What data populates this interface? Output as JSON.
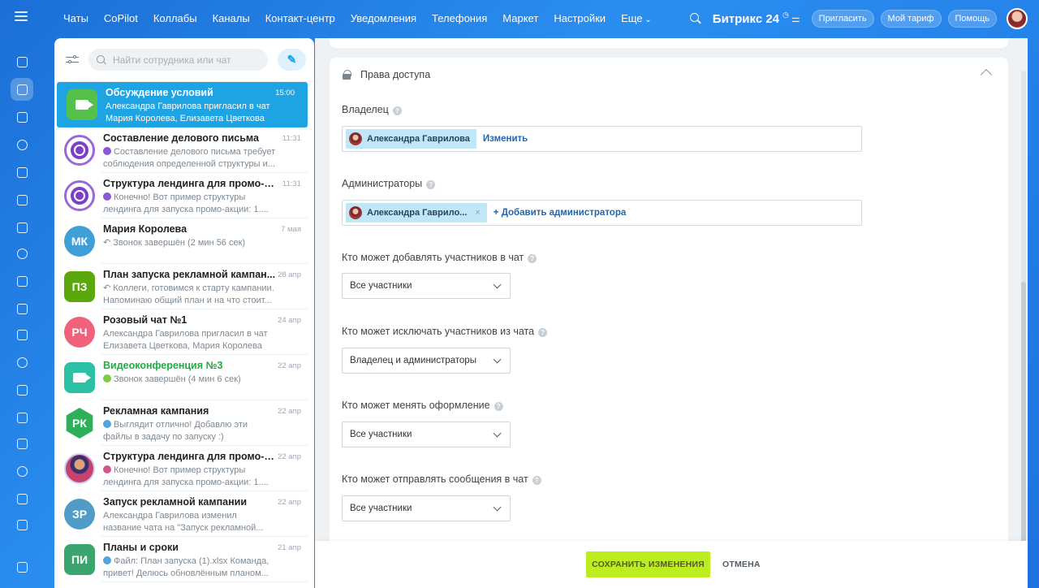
{
  "topnav": {
    "items": [
      "Чаты",
      "CoPilot",
      "Коллабы",
      "Каналы",
      "Контакт-центр",
      "Уведомления",
      "Телефония",
      "Маркет",
      "Настройки"
    ],
    "more": "Еще",
    "logo": "Битрикс 24",
    "invite": "Пригласить",
    "tariff": "Мой тариф",
    "help": "Помощь"
  },
  "rail": {
    "icons": [
      "bolt-icon",
      "chat-icon",
      "feed-icon",
      "copilot-icon",
      "calendar-icon",
      "docs-icon",
      "boards-icon",
      "drive-icon",
      "mail-icon",
      "contacts-icon",
      "tasks-icon",
      "crm-icon",
      "planner-icon",
      "store-icon",
      "goals-icon",
      "shop-icon",
      "forms-icon",
      "sign-icon",
      "settings-icon"
    ]
  },
  "chatlist": {
    "search_placeholder": "Найти сотрудника или чат",
    "compose": "✎",
    "items": [
      {
        "title": "Обсуждение условий",
        "time": "15:00",
        "text": "Александра Гаврилова пригласил в чат Мария Королева, Елизавета Цветкова",
        "avatar": "",
        "color": "#55c04a",
        "active": true
      },
      {
        "title": "Составление делового письма",
        "time": "11:31",
        "text": "Составление делового письма требует соблюдения определенной структуры и...",
        "avatar": "",
        "color": "#ffffff"
      },
      {
        "title": "Структура лендинга для промо-акц...",
        "time": "11:31",
        "text": "Конечно! Вот пример структуры лендинга для запуска промо-акции: 1....",
        "avatar": "",
        "color": "#ffffff"
      },
      {
        "title": "Мария Королева",
        "time": "7 мая",
        "text": "Звонок завершён (2 мин 56 сек)",
        "avatar": "МК",
        "color": "#3f9fd6"
      },
      {
        "title": "План запуска рекламной кампан...",
        "time": "28 апр",
        "text": "Коллеги, готовимся к старту кампании. Напоминаю общий план и на что стоит...",
        "avatar": "ПЗ",
        "color": "#5aa70e"
      },
      {
        "title": "Розовый чат №1",
        "time": "24 апр",
        "text": "Александра Гаврилова пригласил в чат Елизавета Цветкова, Мария Королева",
        "avatar": "РЧ",
        "color": "#f0617c"
      },
      {
        "title": "Видеоконференция №3",
        "time": "22 апр",
        "text": "Звонок завершён (4 мин 6 сек)",
        "avatar": "",
        "color": "#2cc0a4"
      },
      {
        "title": "Рекламная кампания",
        "time": "22 апр",
        "text": "Выглядит отлично! Добавлю эти файлы в задачу по запуску :)",
        "avatar": "РК",
        "color": "#2eb05a"
      },
      {
        "title": "Структура лендинга для промо-ак...",
        "time": "22 апр",
        "text": "Конечно! Вот пример структуры лендинга для запуска промо-акции: 1....",
        "avatar": "",
        "color": "#c7426c"
      },
      {
        "title": "Запуск рекламной кампании",
        "time": "22 апр",
        "text": "Александра Гаврилова изменил название чата на \"Запуск рекламной...",
        "avatar": "ЗР",
        "color": "#4f9cc6"
      },
      {
        "title": "Планы и сроки",
        "time": "21 апр",
        "text": "Файл: План запуска (1).xlsx Команда, привет! Делюсь обновлённым планом...",
        "avatar": "ПИ",
        "color": "#3aa56e"
      }
    ]
  },
  "settings": {
    "section_title": "Права доступа",
    "owner_label": "Владелец",
    "owner_name": "Александра Гаврилова",
    "owner_change": "Изменить",
    "admins_label": "Администраторы",
    "admin_name": "Александра Гаврило...",
    "admin_add": "+ Добавить администратора",
    "remove_icon": "×",
    "help_icon": "?",
    "fields": [
      {
        "label": "Кто может добавлять участников в чат",
        "value": "Все участники"
      },
      {
        "label": "Кто может исключать участников из чата",
        "value": "Владелец и администраторы"
      },
      {
        "label": "Кто может менять оформление",
        "value": "Все участники"
      },
      {
        "label": "Кто может отправлять сообщения в чат",
        "value": "Все участники"
      }
    ]
  },
  "footer": {
    "save": "СОХРАНИТЬ ИЗМЕНЕНИЯ",
    "cancel": "ОТМЕНА"
  }
}
